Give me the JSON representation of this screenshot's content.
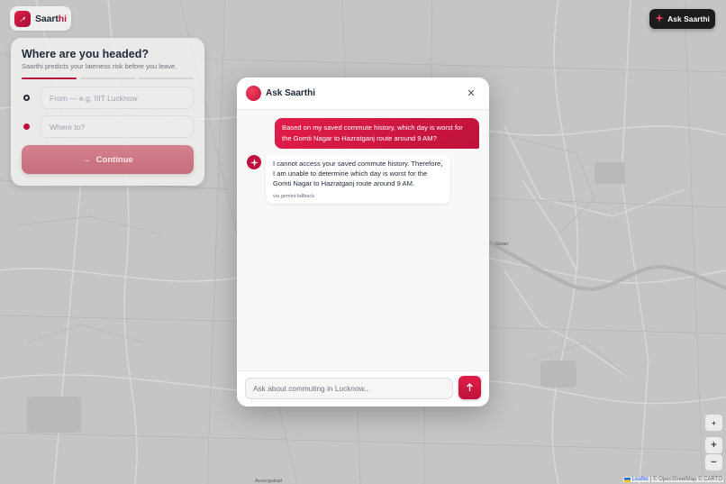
{
  "brand": {
    "name_main": "Saart",
    "name_accent": "hi"
  },
  "header": {
    "ask_button_label": "Ask Saarthi"
  },
  "planner": {
    "title": "Where are you headed?",
    "subtitle": "Saarthi predicts your lateness risk before you leave.",
    "steps_total": 3,
    "steps_active": 1,
    "from_placeholder": "From — e.g. IIIT Lucknow",
    "to_placeholder": "Where to?",
    "continue_label": "Continue"
  },
  "modal": {
    "title": "Ask Saarthi",
    "messages": [
      {
        "role": "user",
        "text": "Based on my saved commute history, which day is worst for the Gomti Nagar to Hazratganj route around 9 AM?"
      },
      {
        "role": "assistant",
        "text": "I cannot access your saved commute history. Therefore, I am unable to determine which day is worst for the Gomti Nagar to Hazratganj route around 9 AM.",
        "source": "via gemini-fallback"
      }
    ],
    "input_placeholder": "Ask about commuting in Lucknow..."
  },
  "map": {
    "labels": {
      "gwari": "Gwari",
      "aurangabad": "Aurangabad"
    },
    "zoom_in": "+",
    "zoom_out": "−",
    "zoom_plus_small": "+",
    "attribution_leaflet": "Leaflet",
    "attribution_rest": "| © OpenStreetMap © CARTO"
  },
  "colors": {
    "accent": "#be123c",
    "dark_button": "#1c1c1e"
  }
}
